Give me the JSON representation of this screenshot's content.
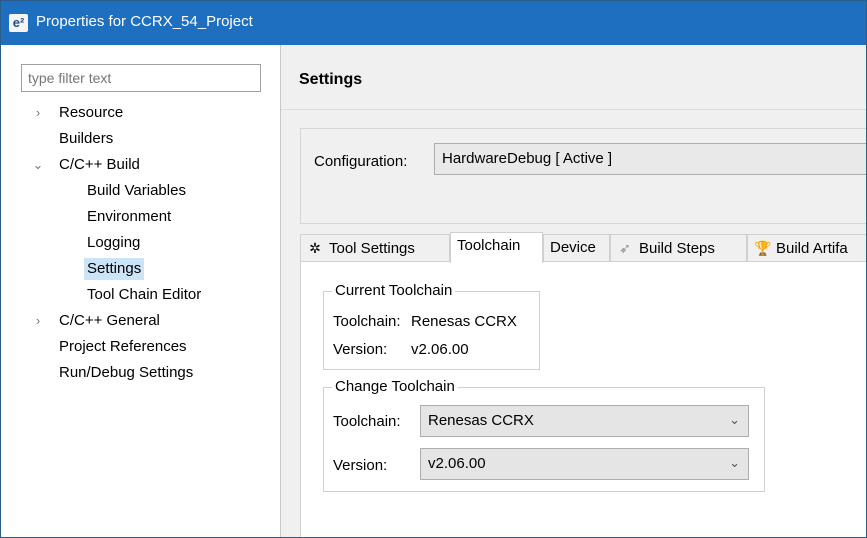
{
  "window": {
    "title": "Properties for CCRX_54_Project",
    "app_icon": "e²"
  },
  "sidebar": {
    "filter_placeholder": "type filter text",
    "items": [
      {
        "label": "Resource",
        "expander": "›"
      },
      {
        "label": "Builders"
      },
      {
        "label": "C/C++ Build",
        "expander": "⌄"
      },
      {
        "label": "Build Variables"
      },
      {
        "label": "Environment"
      },
      {
        "label": "Logging"
      },
      {
        "label": "Settings",
        "selected": true
      },
      {
        "label": "Tool Chain Editor"
      },
      {
        "label": "C/C++ General",
        "expander": "›"
      },
      {
        "label": "Project References"
      },
      {
        "label": "Run/Debug Settings"
      }
    ]
  },
  "main": {
    "title": "Settings",
    "configuration": {
      "label": "Configuration:",
      "value": "HardwareDebug  [ Active ]"
    },
    "tabs": [
      {
        "label": "Tool Settings",
        "icon": "tool-settings-icon",
        "glyph": "✲"
      },
      {
        "label": "Toolchain",
        "active": true
      },
      {
        "label": "Device"
      },
      {
        "label": "Build Steps",
        "icon": "build-steps-icon",
        "glyph": "➶"
      },
      {
        "label": "Build Artifa",
        "icon": "build-artifact-icon",
        "glyph": "🏆"
      }
    ],
    "current_toolchain": {
      "title": "Current Toolchain",
      "toolchain_label": "Toolchain:",
      "toolchain_value": "Renesas CCRX",
      "version_label": "Version:",
      "version_value": "v2.06.00"
    },
    "change_toolchain": {
      "title": "Change Toolchain",
      "toolchain_label": "Toolchain:",
      "toolchain_value": "Renesas CCRX",
      "version_label": "Version:",
      "version_value": "v2.06.00",
      "chevron": "⌄"
    }
  },
  "colors": {
    "titlebar": "#1e6fbf",
    "selection": "#cce4f7"
  }
}
